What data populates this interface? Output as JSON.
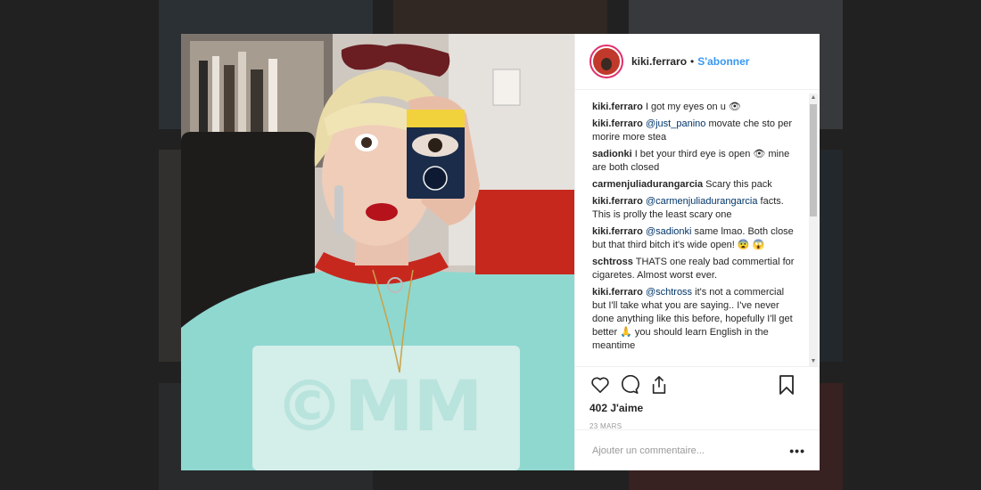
{
  "post": {
    "username": "kiki.ferraro",
    "separator": "•",
    "follow_label": "S'abonner",
    "likes": "402 J'aime",
    "date": "23 MARS",
    "add_comment_placeholder": "Ajouter un commentaire...",
    "more_label": "•••"
  },
  "comments": [
    {
      "user": "kiki.ferraro",
      "mention": "",
      "text": "I got my eyes on u 👁"
    },
    {
      "user": "kiki.ferraro",
      "mention": "@just_panino",
      "text": "movate che sto per morire more stea"
    },
    {
      "user": "sadionki",
      "mention": "",
      "text": "I bet your third eye is open 👁 mine are both closed"
    },
    {
      "user": "carmenjuliadurangarcia",
      "mention": "",
      "text": "Scary this pack"
    },
    {
      "user": "kiki.ferraro",
      "mention": "@carmenjuliadurangarcia",
      "text": "facts. This is prolly the least scary one"
    },
    {
      "user": "kiki.ferraro",
      "mention": "@sadionki",
      "text": "same lmao. Both close but that third bitch it's wide open! 😨 😱"
    },
    {
      "user": "schtross",
      "mention": "",
      "text": "THATS one realy bad commertial for cigaretes. Almost worst ever."
    },
    {
      "user": "kiki.ferraro",
      "mention": "@schtross",
      "text": "it's not a commercial but I'll take what you are saying.. I've never done anything like this before, hopefully I'll get better 🙏 you should learn English in the meantime"
    }
  ],
  "icons": {
    "like": "heart-icon",
    "comment": "comment-icon",
    "share": "share-icon",
    "save": "bookmark-icon",
    "more": "more-icon"
  },
  "colors": {
    "link": "#3897f0",
    "mention": "#003569",
    "story_ring": "#e1306c"
  }
}
